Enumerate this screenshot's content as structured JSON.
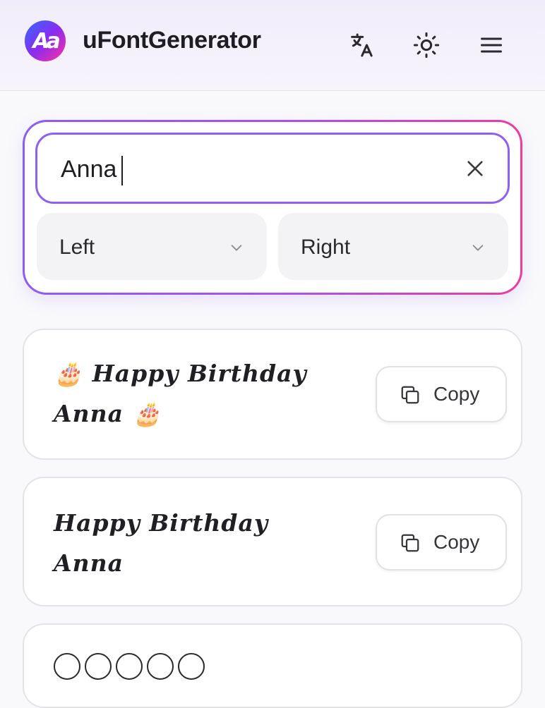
{
  "header": {
    "logo_text": "Aa",
    "title": "uFontGenerator",
    "icons": [
      "translate-icon",
      "sun-icon",
      "menu-icon"
    ]
  },
  "input": {
    "value": "Anna",
    "left_select": "Left",
    "right_select": "Right"
  },
  "results": [
    {
      "line1": "🎂 𝑯𝒂𝒑𝒑𝒚 𝑩𝒊𝒓𝒕𝒉𝒅𝒂𝒚",
      "line2": "𝑨𝒏𝒏𝒂 🎂",
      "copy_label": "Copy"
    },
    {
      "line1": "𝑯𝒂𝒑𝒑𝒚 𝑩𝒊𝒓𝒕𝒉𝒅𝒂𝒚",
      "line2": "𝑨𝒏𝒏𝒂",
      "copy_label": "Copy"
    }
  ],
  "colors": {
    "accent_purple": "#8f5ff4",
    "accent_pink": "#ec3c9c"
  }
}
